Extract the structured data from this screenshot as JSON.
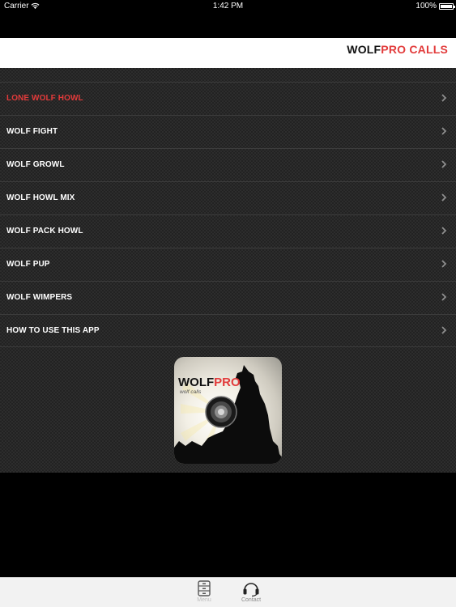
{
  "status_bar": {
    "carrier": "Carrier",
    "time": "1:42 PM",
    "battery": "100%"
  },
  "header": {
    "title_part1": "WOLF",
    "title_part2": "PRO CALLS",
    "accent_color": "#e23b3b"
  },
  "menu": {
    "items": [
      {
        "label": "LONE WOLF HOWL",
        "active": true
      },
      {
        "label": "WOLF FIGHT"
      },
      {
        "label": "WOLF GROWL"
      },
      {
        "label": "WOLF HOWL MIX"
      },
      {
        "label": "WOLF PACK HOWL"
      },
      {
        "label": "WOLF PUP"
      },
      {
        "label": "WOLF WIMPERS"
      },
      {
        "label": "HOW TO USE THIS APP"
      }
    ]
  },
  "app_icon": {
    "title_part1": "WOLF",
    "title_part2": "PRO",
    "subtitle": "wolf calls",
    "icons": [
      "speaker-icon",
      "howling-wolf-icon"
    ]
  },
  "tab_bar": {
    "tabs": [
      {
        "label": "Menu",
        "icon": "menu-drawer-icon",
        "selected": true
      },
      {
        "label": "Contact",
        "icon": "headset-icon"
      }
    ]
  }
}
